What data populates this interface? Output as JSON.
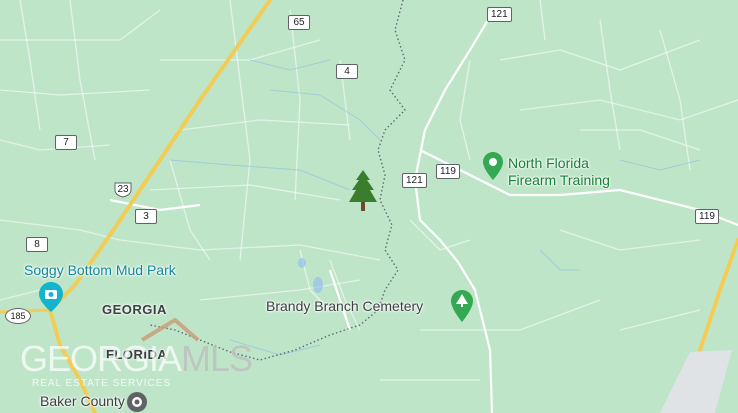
{
  "map": {
    "background_color": "#bfe5c9",
    "road_color": "#ffffff",
    "highway_color": "#f2cc55",
    "water_color": "#8ab4f8"
  },
  "route_shields": {
    "r65": "65",
    "r121_top": "121",
    "r4": "4",
    "r7": "7",
    "r23": "23",
    "r3": "3",
    "r8": "8",
    "r121_mid": "121",
    "r119_left": "119",
    "r119_right": "119",
    "r185": "185"
  },
  "pois": {
    "firearm": {
      "name": "North Florida Firearm Training",
      "line1": "North Florida",
      "line2": "Firearm Training",
      "icon": "pin-icon"
    },
    "mudpark": {
      "name": "Soggy Bottom Mud Park",
      "icon": "camera-icon"
    },
    "cemetery": {
      "name": "Brandy Branch Cemetery",
      "icon": "tree-icon"
    },
    "animal": {
      "name": "Baker County Animal Control",
      "line1": "Baker County",
      "icon": "info-icon"
    }
  },
  "state_labels": {
    "georgia": "GEORGIA",
    "florida": "FLORIDA"
  },
  "marker": {
    "icon": "pine-tree-icon",
    "color": "#3a7d2c"
  },
  "watermark": {
    "brand_left": "GEORGIA",
    "brand_right": "MLS",
    "tagline": "REAL ESTATE SERVICES"
  }
}
